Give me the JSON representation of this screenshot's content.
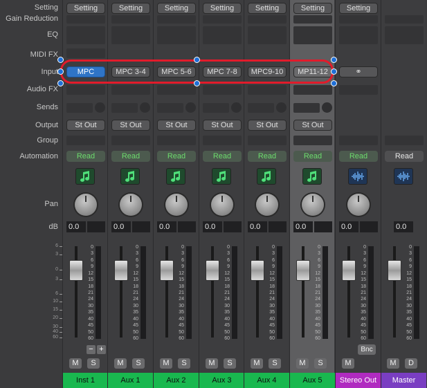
{
  "row_labels": {
    "setting": "Setting",
    "gain_reduction": "Gain Reduction",
    "eq": "EQ",
    "midi_fx": "MIDI FX",
    "input": "Input",
    "audio_fx": "Audio FX",
    "sends": "Sends",
    "output": "Output",
    "group": "Group",
    "automation": "Automation",
    "pan": "Pan",
    "db": "dB"
  },
  "strips": [
    {
      "name": "Inst 1",
      "setting": "Setting",
      "input": "MPC",
      "output": "St Out",
      "automation": "Read",
      "db": "0.0",
      "icon": "music-note-icon",
      "mute": "M",
      "solo": "S"
    },
    {
      "name": "Aux 1",
      "setting": "Setting",
      "input": "MPC 3-4",
      "output": "St Out",
      "automation": "Read",
      "db": "0.0",
      "icon": "music-note-icon",
      "mute": "M",
      "solo": "S"
    },
    {
      "name": "Aux 2",
      "setting": "Setting",
      "input": "MPC 5-6",
      "output": "St Out",
      "automation": "Read",
      "db": "0.0",
      "icon": "music-note-icon",
      "mute": "M",
      "solo": "S"
    },
    {
      "name": "Aux 3",
      "setting": "Setting",
      "input": "MPC 7-8",
      "output": "St Out",
      "automation": "Read",
      "db": "0.0",
      "icon": "music-note-icon",
      "mute": "M",
      "solo": "S"
    },
    {
      "name": "Aux 4",
      "setting": "Setting",
      "input": "MPC9-10",
      "output": "St Out",
      "automation": "Read",
      "db": "0.0",
      "icon": "music-note-icon",
      "mute": "M",
      "solo": "S"
    },
    {
      "name": "Aux 5",
      "setting": "Setting",
      "input": "MP11-12",
      "output": "St Out",
      "automation": "Read",
      "db": "0.0",
      "icon": "music-note-icon",
      "mute": "M",
      "solo": "S"
    },
    {
      "name": "Stereo Out",
      "setting": "Setting",
      "input": "",
      "output": "",
      "automation": "Read",
      "db": "0.0",
      "icon": "waveform-icon",
      "mute": "M",
      "solo": "",
      "bnc": "Bnc"
    },
    {
      "name": "Master",
      "setting": "",
      "input": "",
      "output": "",
      "automation": "Read",
      "db": "0.0",
      "icon": "waveform-icon",
      "mute": "M",
      "solo": "D"
    }
  ],
  "fader_scale": [
    "0",
    "3",
    "6",
    "9",
    "12",
    "15",
    "18",
    "21",
    "24",
    "30",
    "35",
    "40",
    "45",
    "50",
    "60"
  ],
  "left_scale": [
    "6",
    "3",
    "0",
    "3",
    "6",
    "10",
    "15",
    "20",
    "30",
    "40",
    "60"
  ],
  "colors": {
    "selected_input": "#2f74c7",
    "automation_read": "#6ddc6d",
    "track_green": "#19b84f",
    "stereo_out": "#b02bc0",
    "master": "#7a3ec2",
    "highlight_outline": "#e21b2b"
  },
  "track_controls": {
    "minus": "−",
    "plus": "+"
  }
}
